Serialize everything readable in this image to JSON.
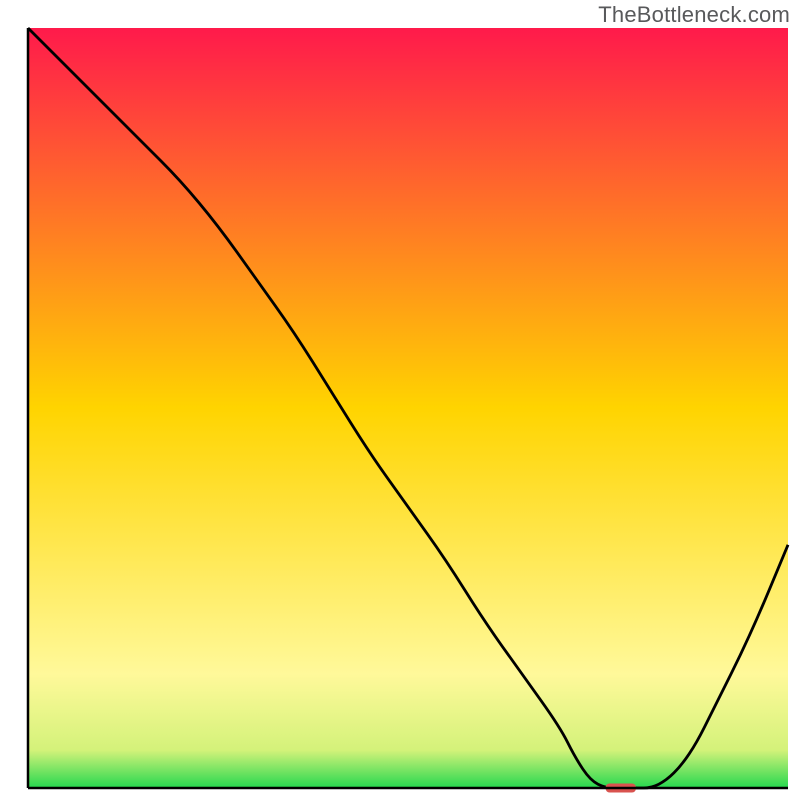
{
  "watermark": "TheBottleneck.com",
  "chart_data": {
    "type": "line",
    "title": "",
    "xlabel": "",
    "ylabel": "",
    "xlim": [
      0,
      100
    ],
    "ylim": [
      0,
      100
    ],
    "x": [
      0,
      5,
      10,
      15,
      20,
      25,
      30,
      35,
      40,
      45,
      50,
      55,
      60,
      65,
      70,
      72,
      74,
      76,
      78,
      80,
      82,
      84,
      86,
      88,
      90,
      95,
      100
    ],
    "values": [
      100,
      95,
      90,
      85,
      80,
      74,
      67,
      60,
      52,
      44,
      37,
      30,
      22,
      15,
      8,
      4,
      1,
      0,
      0,
      0,
      0,
      1,
      3,
      6,
      10,
      20,
      32
    ],
    "marker": {
      "x_start": 76,
      "x_end": 80,
      "y": 0
    },
    "gradient_stops": [
      {
        "offset": 0,
        "color": "#ff1a4b"
      },
      {
        "offset": 50,
        "color": "#ffd400"
      },
      {
        "offset": 85,
        "color": "#fff99a"
      },
      {
        "offset": 95,
        "color": "#d4f27a"
      },
      {
        "offset": 100,
        "color": "#26d84f"
      }
    ],
    "axis_color": "#000000",
    "line_color": "#000000",
    "marker_color": "#d9534f"
  }
}
